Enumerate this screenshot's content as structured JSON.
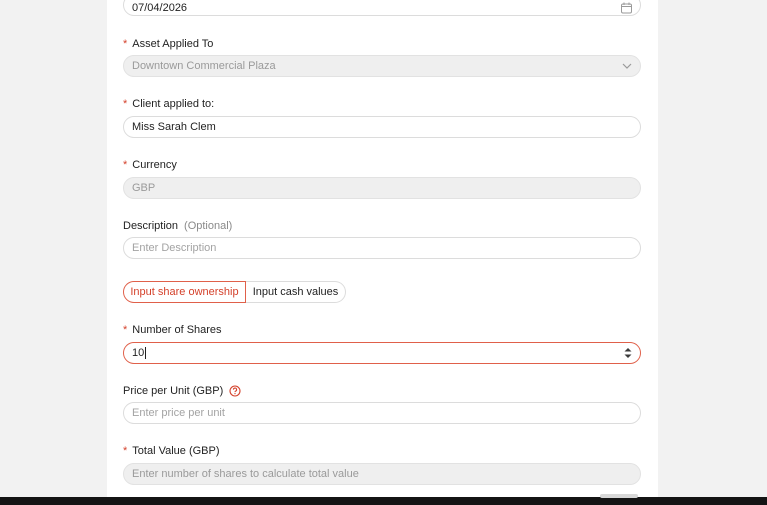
{
  "date_field": {
    "value": "07/04/2026",
    "icon": "calendar-icon"
  },
  "asset": {
    "label": "Asset Applied To",
    "value": "Downtown Commercial Plaza",
    "icon": "chevron-down-icon"
  },
  "client": {
    "label": "Client applied to:",
    "value": "Miss Sarah Clem"
  },
  "currency": {
    "label": "Currency",
    "value": "GBP"
  },
  "description": {
    "label": "Description",
    "optional": "(Optional)",
    "placeholder": "Enter Description"
  },
  "mode_toggle": {
    "share_label": "Input share ownership",
    "cash_label": "Input cash values",
    "selected": "share"
  },
  "shares": {
    "label": "Number of Shares",
    "value": "10",
    "icon": "stepper-icon"
  },
  "price": {
    "label": "Price per Unit (GBP)",
    "placeholder": "Enter price per unit",
    "icon": "help-circle-icon"
  },
  "total": {
    "label": "Total Value (GBP)",
    "placeholder": "Enter number of shares to calculate total value"
  },
  "required_marker": "*",
  "colors": {
    "accent": "#d4412b",
    "disabled_bg": "#efefef",
    "border": "#dcdcdc"
  }
}
